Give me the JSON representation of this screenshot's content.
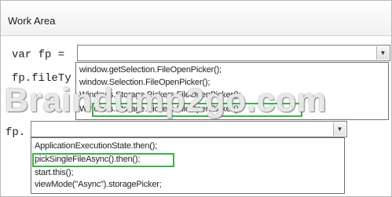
{
  "panel": {
    "title": "Work Area"
  },
  "code": {
    "line1_prefix": "var fp =",
    "line2_prefix": "fp.fileTy",
    "line3_prefix": "fp."
  },
  "dropdown1": {
    "value": "",
    "options": [
      "window.getSelection.FileOpenPicker();",
      "window.Selection.FileOpenPicker();",
      "Windows.Storage.Pickers.FileOpenPicker();",
      "Windows.Storage.Pickers.FileOpenPicker();"
    ],
    "highlighted_index": 3
  },
  "dropdown2": {
    "value": "",
    "options": [
      "ApplicationExecutionState.then();",
      "pickSingleFileAsync().then();",
      "start.this();",
      "viewMode(\"Async\").storagePicker;"
    ],
    "highlighted_index": 1
  },
  "watermark": "Braindump2go.com",
  "colors": {
    "highlight": "#3db14a",
    "border": "#7f7f7f"
  }
}
